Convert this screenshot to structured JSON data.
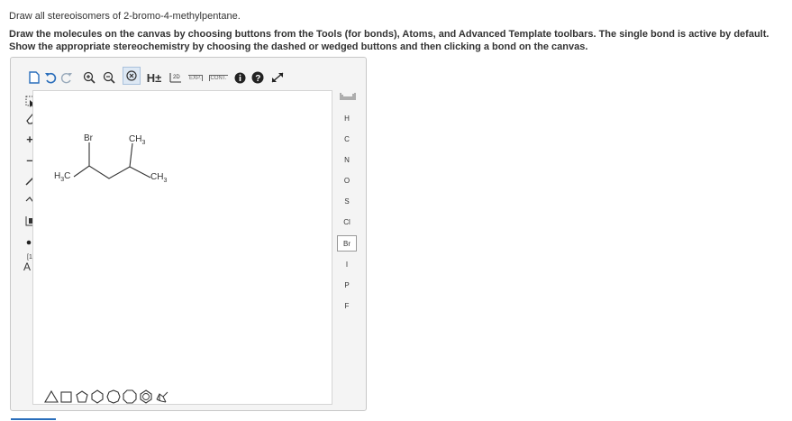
{
  "question": {
    "title": "Draw all stereoisomers of 2-bromo-4-methylpentane.",
    "instructions": "Draw the molecules on the canvas by choosing buttons from the Tools (for bonds), Atoms, and Advanced Template toolbars. The single bond is active by default. Show the appropriate stereochemistry by choosing the dashed or wedged buttons and then clicking a bond on the canvas."
  },
  "toolbar": {
    "h_label": "H±",
    "exp_label": "EXP.",
    "cont_label": "CONT.",
    "two_d_label": "2D"
  },
  "left_tools": {
    "charge_label": "[1]",
    "atom_label": "A"
  },
  "atoms": {
    "selected": "Br",
    "items": [
      "H",
      "C",
      "N",
      "O",
      "S",
      "Cl",
      "Br",
      "I",
      "P",
      "F"
    ]
  },
  "molecule": {
    "br_label": "Br",
    "ch3_top": "CH",
    "ch3_top_sub": "3",
    "h3c_left_main": "H",
    "h3c_left_sub": "3",
    "h3c_left_tail": "C",
    "ch3_right": "CH",
    "ch3_right_sub": "3"
  }
}
